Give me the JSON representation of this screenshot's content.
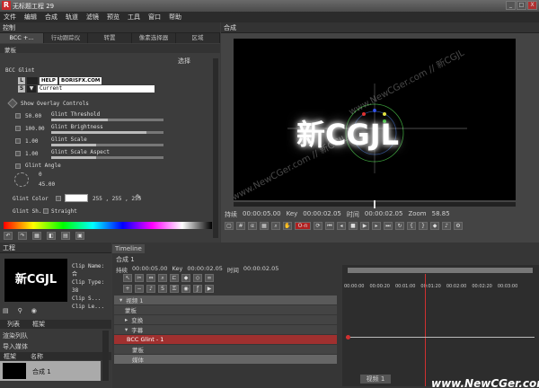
{
  "titlebar": {
    "logo": "R",
    "title": "无标题工程 29",
    "min": "_",
    "max": "□",
    "close": "X"
  },
  "menu": [
    "文件",
    "编辑",
    "合成",
    "轨道",
    "滤镜",
    "预览",
    "工具",
    "窗口",
    "帮助"
  ],
  "control_panel": {
    "title": "控制",
    "tabs": [
      "BCC +...",
      "行动跟踪仪",
      "转置",
      "像素选择器",
      "区域"
    ],
    "sub_tab": "蒙板",
    "select_label": "选择",
    "filter_name": "BCC Glint",
    "help_label": "HELP",
    "boris_label": "BORISFX.COM",
    "preset_value": "Current",
    "show_overlay": "Show Overlay Controls",
    "params": [
      {
        "value": "50.00",
        "label": "Glint Threshold",
        "level": 0.5
      },
      {
        "value": "100.00",
        "label": "Glint Brightness",
        "level": 0.85
      },
      {
        "value": "1.00",
        "label": "Glint Scale",
        "level": 0.4
      },
      {
        "value": "1.00",
        "label": "Glint Scale Aspect",
        "level": 0.4
      }
    ],
    "angle_label": "Glint Angle",
    "angle_rev": "0",
    "angle_deg": "45.00",
    "color_label": "Glint Color",
    "color_values": "255 , 255 , 255",
    "shape_label": "Glint Sh...",
    "shape_value": "Straight"
  },
  "viewer": {
    "title": "合成",
    "watermarks": [
      "www.NewCGer.com // 新CGJL",
      "www.NewCGer.com // 新CGJL",
      "www.NewCGer.com"
    ],
    "logo_text": "新CGJL",
    "duration_label": "持续",
    "duration": "00:00:05.00",
    "key_label": "Key",
    "key": "00:00:02.05",
    "time_label": "时间",
    "time": "00:00:02.05",
    "zoom_label": "Zoom",
    "zoom": "58.85",
    "record_label": "O-n"
  },
  "project": {
    "title": "工程",
    "thumb_text": "新CGJL",
    "info_labels": [
      "Clip Name: 合",
      "Clip Type: 38",
      "Clip S...",
      "Clip Le..."
    ],
    "tabs": [
      "列表",
      "框架"
    ],
    "group_label": "渲染列队",
    "import_label": "导入媒体",
    "col_frame": "框架",
    "col_name": "名称",
    "item_name": "合成 1"
  },
  "timeline": {
    "tab": "Timeline",
    "comp": "合成 1",
    "duration_label": "持续",
    "duration": "00:00:05.00",
    "key_label": "Key",
    "key": "00:00:02.05",
    "time_label": "时间",
    "time": "00:00:02.05",
    "tracks": [
      "视频 1",
      "蒙板",
      "变换",
      "字幕",
      "BCC Glint - 1",
      "蒙板",
      "媒体"
    ],
    "ruler": [
      "00:00",
      "00:00:00",
      "00:00:20",
      "00:01:00",
      "00:01:20",
      "00:02:00",
      "00:02:20",
      "00:03:00",
      "00:03:20",
      "00:04:00",
      "00:04:20"
    ],
    "clip_label": "视频 1",
    "footer_logo": "www.NewCGer.com"
  },
  "colors": {
    "accent_red": "#c8282a",
    "track_red": "#a0302f",
    "panel": "#3c3c3c",
    "playhead": "#d03030"
  }
}
